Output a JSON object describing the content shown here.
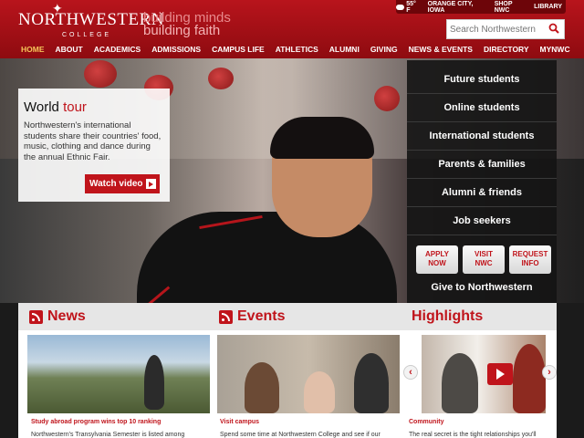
{
  "header": {
    "logo_name": "NORTHWESTERN",
    "logo_sub": "COLLEGE",
    "tagline_1": "building minds",
    "tagline_2": "building faith",
    "weather": "55° F",
    "utility_links": [
      "ORANGE CITY, IOWA",
      "SHOP NWC",
      "LIBRARY"
    ],
    "search_placeholder": "Search Northwestern"
  },
  "nav": [
    "HOME",
    "ABOUT",
    "ACADEMICS",
    "ADMISSIONS",
    "CAMPUS LIFE",
    "ATHLETICS",
    "ALUMNI",
    "GIVING",
    "NEWS & EVENTS",
    "DIRECTORY",
    "MYNWC"
  ],
  "nav_active_index": 0,
  "feature": {
    "title_1": "World",
    "title_2": "tour",
    "body": "Northwestern's international students share their countries' food, music, clothing and dance during the annual Ethnic Fair.",
    "button": "Watch video"
  },
  "audience": [
    "Future students",
    "Online students",
    "International students",
    "Parents & families",
    "Alumni & friends",
    "Job seekers"
  ],
  "quick_buttons": [
    [
      "APPLY",
      "NOW"
    ],
    [
      "VISIT",
      "NWC"
    ],
    [
      "REQUEST",
      "INFO"
    ]
  ],
  "give": "Give to Northwestern",
  "sections": {
    "news": {
      "heading": "News",
      "caption": "Study abroad program wins top 10 ranking",
      "desc": "Northwestern's Transylvania Semester is listed among"
    },
    "events": {
      "heading": "Events",
      "caption": "Visit campus",
      "desc": "Spend some time at Northwestern College and see if our"
    },
    "highlights": {
      "heading": "Highlights",
      "caption": "Community",
      "desc": "The real secret is the tight relationships you'll"
    }
  },
  "colors": {
    "brand_red": "#c0141b",
    "nav_active": "#f6c65a"
  }
}
